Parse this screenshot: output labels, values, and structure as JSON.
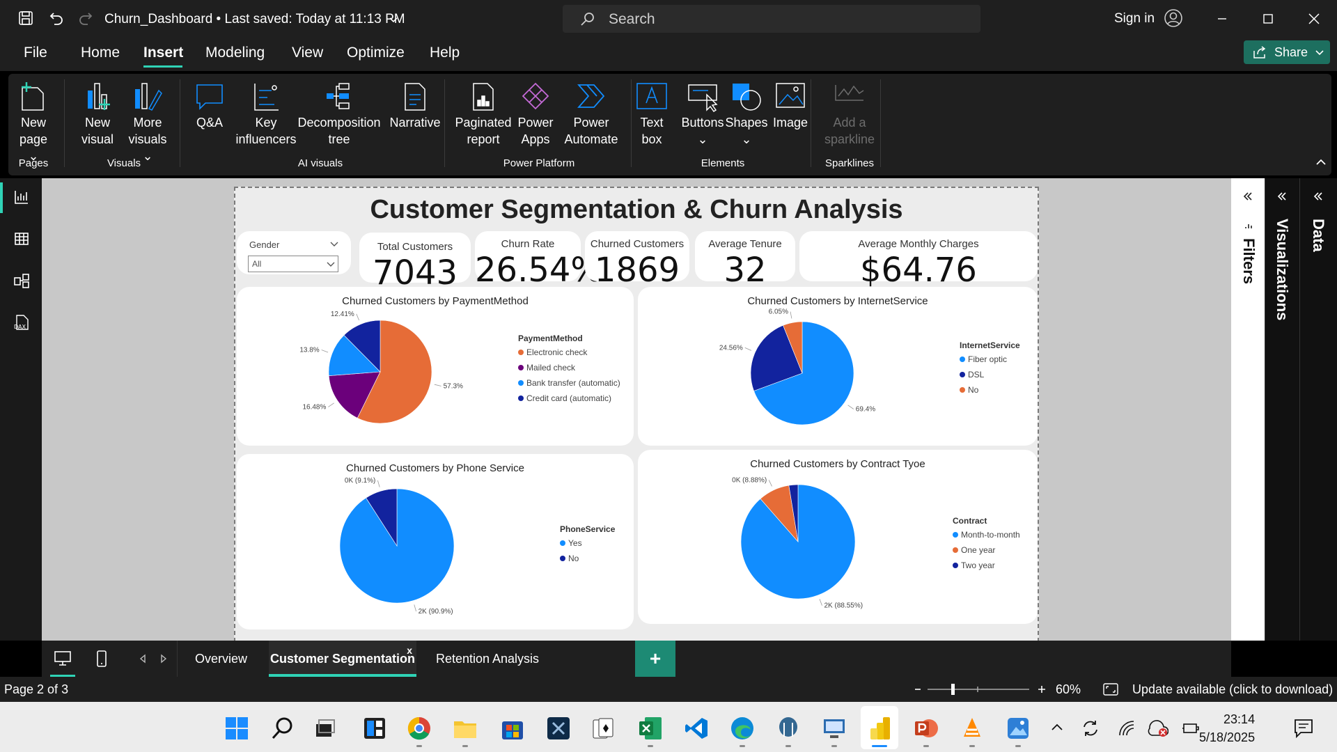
{
  "titlebar": {
    "title": "Churn_Dashboard • Last saved: Today at 11:13 PM",
    "search_placeholder": "Search",
    "sign_in": "Sign in"
  },
  "menu": {
    "items": [
      "File",
      "Home",
      "Insert",
      "Modeling",
      "View",
      "Optimize",
      "Help"
    ],
    "active": "Insert",
    "share": "Share"
  },
  "ribbon": {
    "new_page": [
      "New",
      "page"
    ],
    "new_visual": [
      "New",
      "visual"
    ],
    "more_visuals": [
      "More",
      "visuals"
    ],
    "qa": "Q&A",
    "key_influencers": [
      "Key",
      "influencers"
    ],
    "decomposition_tree": [
      "Decomposition",
      "tree"
    ],
    "narrative": "Narrative",
    "paginated_report": [
      "Paginated",
      "report"
    ],
    "power_apps": [
      "Power",
      "Apps"
    ],
    "power_automate": [
      "Power",
      "Automate"
    ],
    "text_box": [
      "Text",
      "box"
    ],
    "buttons": "Buttons",
    "shapes": "Shapes",
    "image": "Image",
    "sparkline": [
      "Add a",
      "sparkline"
    ],
    "groups": {
      "pages": "Pages",
      "visuals": "Visuals",
      "ai_visuals": "AI visuals",
      "power_platform": "Power Platform",
      "elements": "Elements",
      "sparklines": "Sparklines"
    }
  },
  "report": {
    "title": "Customer Segmentation & Churn Analysis",
    "slicer": {
      "label": "Gender",
      "value": "All"
    },
    "kpis": [
      {
        "label": "Total Customers",
        "value": "7043"
      },
      {
        "label": "Churn Rate",
        "value": "26.54%"
      },
      {
        "label": "Churned Customers",
        "value": "1869"
      },
      {
        "label": "Average Tenure",
        "value": "32"
      },
      {
        "label": "Average Monthly Charges",
        "value": "$64.76"
      }
    ]
  },
  "chart_data": [
    {
      "type": "pie",
      "title": "Churned Customers by PaymentMethod",
      "legend_title": "PaymentMethod",
      "legend_placement": "right",
      "series": [
        {
          "name": "Electronic check",
          "value": 57.3,
          "label": "57.3%",
          "color": "#E66C37"
        },
        {
          "name": "Mailed check",
          "value": 16.48,
          "label": "16.48%",
          "color": "#6B007B"
        },
        {
          "name": "Bank transfer (automatic)",
          "value": 13.8,
          "label": "13.8%",
          "color": "#118DFF"
        },
        {
          "name": "Credit card (automatic)",
          "value": 12.41,
          "label": "12.41%",
          "color": "#12239E"
        }
      ]
    },
    {
      "type": "pie",
      "title": "Churned Customers by InternetService",
      "legend_title": "InternetService",
      "legend_placement": "right",
      "series": [
        {
          "name": "Fiber optic",
          "value": 69.4,
          "label": "69.4%",
          "color": "#118DFF"
        },
        {
          "name": "DSL",
          "value": 24.56,
          "label": "24.56%",
          "color": "#12239E"
        },
        {
          "name": "No",
          "value": 6.05,
          "label": "6.05%",
          "color": "#E66C37"
        }
      ]
    },
    {
      "type": "pie",
      "title": "Churned Customers by Phone Service",
      "legend_title": "PhoneService",
      "legend_placement": "right",
      "series": [
        {
          "name": "Yes",
          "value": 90.9,
          "label": "2K (90.9%)",
          "color": "#118DFF"
        },
        {
          "name": "No",
          "value": 9.1,
          "label": "0K (9.1%)",
          "color": "#12239E"
        }
      ]
    },
    {
      "type": "pie",
      "title": "Churned Customers by Contract Tyoe",
      "legend_title": "Contract",
      "legend_placement": "right",
      "series": [
        {
          "name": "Month-to-month",
          "value": 88.55,
          "label": "2K (88.55%)",
          "color": "#118DFF"
        },
        {
          "name": "One year",
          "value": 8.88,
          "label": "0K (8.88%)",
          "color": "#E66C37"
        },
        {
          "name": "Two year",
          "value": 2.57,
          "label": "",
          "color": "#12239E"
        }
      ]
    }
  ],
  "panes": {
    "filters": "Filters",
    "visualizations": "Visualizations",
    "data": "Data"
  },
  "tabs": {
    "items": [
      "Overview",
      "Customer Segmentation",
      "Retention Analysis"
    ],
    "active": "Customer Segmentation",
    "close": "x",
    "add": "+"
  },
  "status": {
    "page": "Page 2 of 3",
    "zoom": "60%",
    "update": "Update available (click to download)"
  },
  "taskbar": {
    "time": "23:14",
    "date": "5/18/2025"
  }
}
